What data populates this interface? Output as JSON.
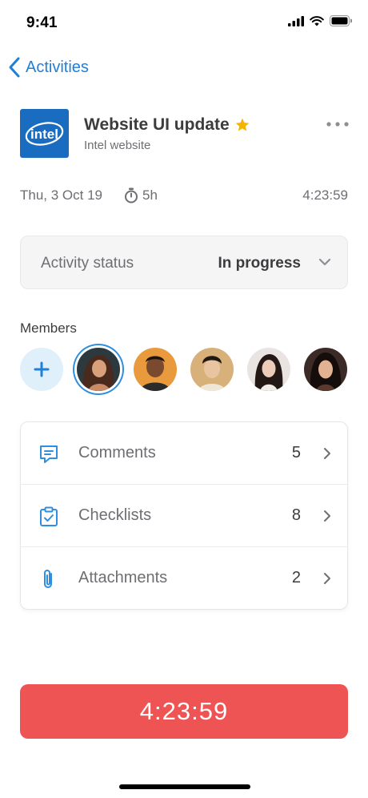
{
  "status_bar": {
    "time": "9:41"
  },
  "nav": {
    "back_label": "Activities"
  },
  "activity": {
    "title": "Website UI update",
    "subtitle": "Intel website",
    "logo_text": "intel",
    "starred": true,
    "date": "Thu, 3 Oct 19",
    "duration": "5h",
    "elapsed": "4:23:59"
  },
  "status_select": {
    "label": "Activity status",
    "value": "In progress"
  },
  "members": {
    "label": "Members",
    "avatars": [
      {
        "name": "member-1",
        "color": "#8a5a3c",
        "selected": true
      },
      {
        "name": "member-2",
        "color": "#6a3b20",
        "selected": false
      },
      {
        "name": "member-3",
        "color": "#c9a27a",
        "selected": false
      },
      {
        "name": "member-4",
        "color": "#d8c7bd",
        "selected": false
      },
      {
        "name": "member-5",
        "color": "#3a2620",
        "selected": false
      }
    ]
  },
  "details": {
    "rows": [
      {
        "label": "Comments",
        "count": "5",
        "icon": "comment-icon"
      },
      {
        "label": "Checklists",
        "count": "8",
        "icon": "clipboard-check-icon"
      },
      {
        "label": "Attachments",
        "count": "2",
        "icon": "paperclip-icon"
      }
    ]
  },
  "timer": {
    "label": "4:23:59"
  },
  "colors": {
    "accent": "#1f7fd9",
    "timer_bg": "#ef5454",
    "star": "#f5b400",
    "logo_bg": "#1a6cc1"
  }
}
